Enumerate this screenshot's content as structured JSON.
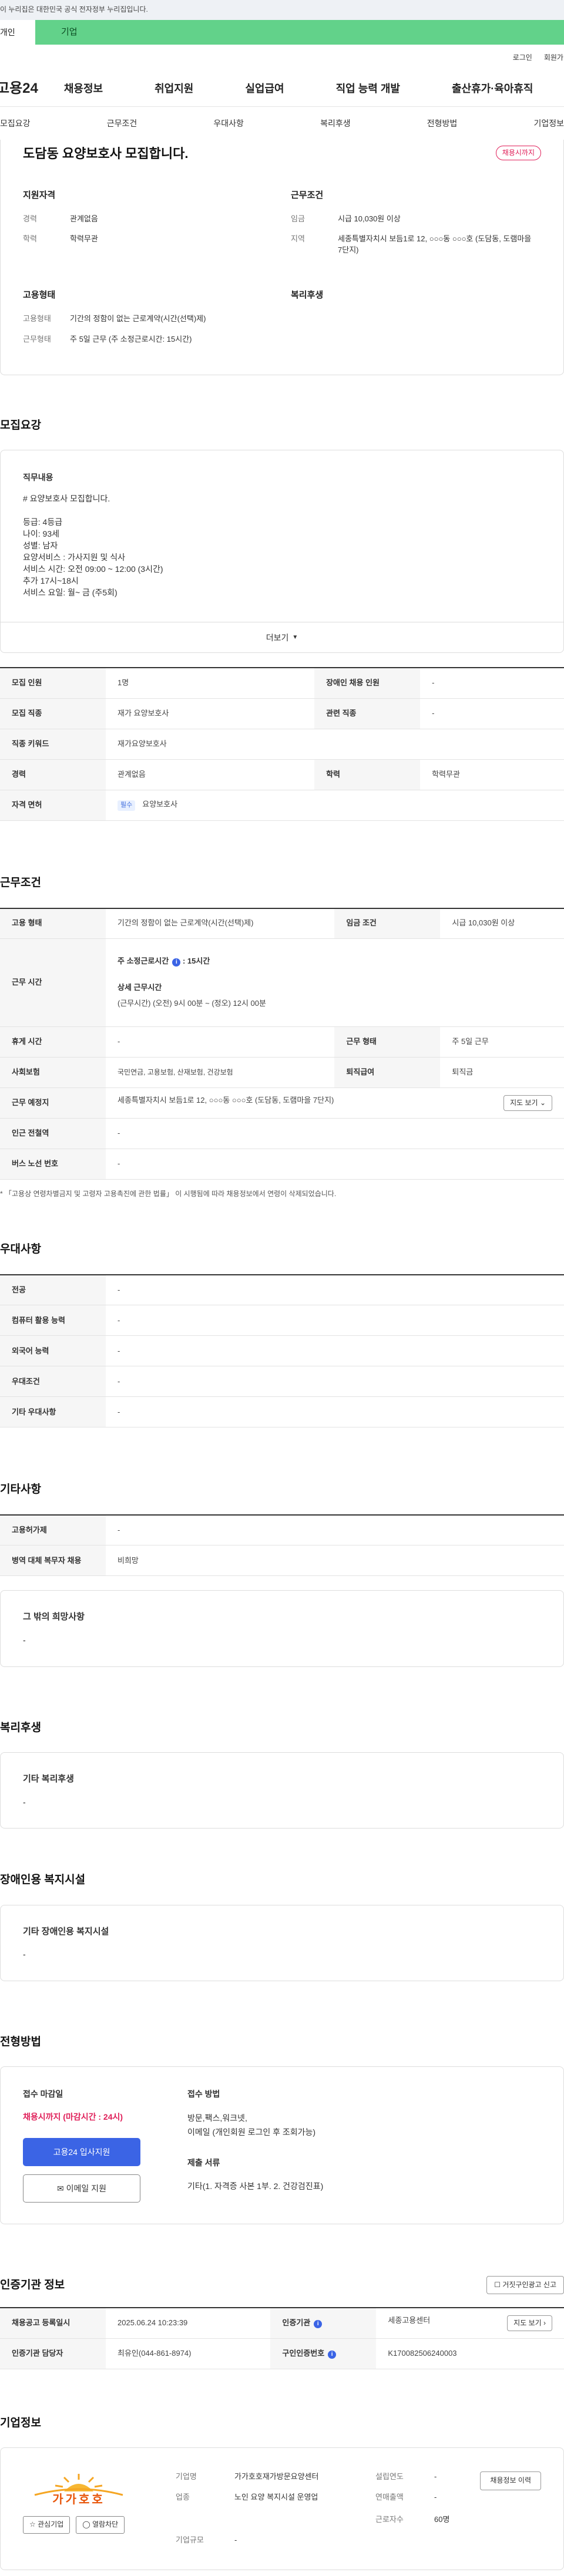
{
  "gov_banner": "이 누리집은 대한민국 공식 전자정부 누리집입니다.",
  "site_tabs": [
    "개인",
    "기업"
  ],
  "util_links": [
    "로그인",
    "회원가입"
  ],
  "logo": "고용24",
  "main_nav": [
    "채용정보",
    "취업지원",
    "실업급여",
    "직업 능력 개발",
    "출산휴가·육아휴직"
  ],
  "anchors": [
    "모집요강",
    "근무조건",
    "우대사항",
    "복리후생",
    "전형방법",
    "기업정보"
  ],
  "summary": {
    "title": "도담동 요양보호사 모집합니다.",
    "status": "채용시까지",
    "qual": {
      "head": "지원자격",
      "rows": [
        {
          "k": "경력",
          "v": "관계없음"
        },
        {
          "k": "학력",
          "v": "학력무관"
        }
      ]
    },
    "cond": {
      "head": "근무조건",
      "rows": [
        {
          "k": "임금",
          "v": "시급 10,030원 이상"
        },
        {
          "k": "지역",
          "v": "세종특별자치시 보듬1로 12, ○○○동 ○○○호 (도담동, 도램마을 7단지)"
        }
      ]
    },
    "emp": {
      "head": "고용형태",
      "rows": [
        {
          "k": "고용형태",
          "v": "기간의 정함이 없는 근로계약(시간(선택)제)"
        },
        {
          "k": "근무형태",
          "v": "주 5일 근무 (주 소정근로시간: 15시간)"
        }
      ]
    },
    "welfare": {
      "head": "복리후생"
    }
  },
  "recruit": {
    "heading": "모집요강",
    "duty_label": "직무내용",
    "duty_text": "# 요양보호사 모집합니다.\n\n등급: 4등급\n나이: 93세\n성별: 남자\n요양서비스 : 가사지원 및 식사\n서비스 시간: 오전 09:00 ~ 12:00 (3시간)\n추가 17시~18시\n서비스 요일: 월~ 금 (주5회)",
    "more": "더보기",
    "rows": [
      {
        "k1": "모집 인원",
        "v1": "1명",
        "k2": "장애인 채용 인원",
        "v2": "-"
      },
      {
        "k1": "모집 직종",
        "v1": "재가 요양보호사",
        "k2": "관련 직종",
        "v2": "-"
      },
      {
        "k1": "직종 키워드",
        "v1": "재가요양보호사"
      },
      {
        "k1": "경력",
        "v1": "관계없음",
        "k2": "학력",
        "v2": "학력무관"
      }
    ],
    "license_label": "자격 면허",
    "license_badge": "필수",
    "license_value": "요양보호사"
  },
  "work": {
    "heading": "근무조건",
    "emp_type_k": "고용 형태",
    "emp_type_v": "기간의 정함이 없는 근로계약(시간(선택)제)",
    "wage_k": "임금 조건",
    "wage_v": "시급 10,030원 이상",
    "hours_k": "근무 시간",
    "weekly_hours": "주 소정근로시간",
    "weekly_hours_v": "15시간",
    "detail_hours": "상세 근무시간",
    "detail_hours_v": "(근무시간) (오전) 9시 00분 ~ (정오) 12시 00분",
    "rest_k": "휴게 시간",
    "rest_v": "-",
    "form_k": "근무 형태",
    "form_v": "주 5일 근무",
    "ins_k": "사회보험",
    "ins_v": "국민연금, 고용보험, 산재보험, 건강보험",
    "ret_k": "퇴직급여",
    "ret_v": "퇴직금",
    "place_k": "근무 예정지",
    "place_v": "세종특별자치시 보듬1로 12, ○○○동 ○○○호 (도담동, 도램마을 7단지)",
    "map_btn": "지도 보기",
    "subway_k": "인근 전철역",
    "subway_v": "-",
    "bus_k": "버스 노선 번호",
    "bus_v": "-",
    "note": "* 「고용상 연령차별금지 및 고령자 고용촉진에 관한 법률」 이 시행됨에 따라 채용정보에서 연령이 삭제되었습니다."
  },
  "pref": {
    "heading": "우대사항",
    "rows": [
      {
        "k": "전공",
        "v": "-"
      },
      {
        "k": "컴퓨터 활용 능력",
        "v": "-"
      },
      {
        "k": "외국어 능력",
        "v": "-"
      },
      {
        "k": "우대조건",
        "v": "-"
      },
      {
        "k": "기타 우대사항",
        "v": "-"
      }
    ]
  },
  "etc": {
    "heading": "기타사항",
    "rows": [
      {
        "k": "고용허가제",
        "v": "-"
      },
      {
        "k": "병역 대체 복무자 채용",
        "v": "비희망"
      }
    ],
    "other_label": "그 밖의 희망사항",
    "other_v": "-"
  },
  "welfare": {
    "heading": "복리후생",
    "label": "기타 복리후생",
    "v": "-"
  },
  "disability": {
    "heading": "장애인용 복지시설",
    "label": "기타 장애인용 복지시설",
    "v": "-"
  },
  "selection": {
    "heading": "전형방법",
    "deadline_label": "접수 마감일",
    "deadline_v": "채용시까지 (마감시간 : 24시)",
    "apply_btn": "고용24 입사지원",
    "email_btn": "이메일 지원",
    "method_label": "접수 방법",
    "method_v1": "방문,팩스,워크넷,",
    "method_v2": "이메일 (개인회원 로그인 후 조회가능)",
    "docs_label": "제출 서류",
    "docs_v": "기타(1. 자격증 사본 1부. 2. 건강검진표)"
  },
  "cert": {
    "heading": "인증기관 정보",
    "report_btn": "거짓구인광고 신고",
    "reg_k": "채용공고 등록일시",
    "reg_v": "2025.06.24 10:23:39",
    "org_k": "인증기관",
    "org_v": "세종고용센터",
    "mgr_k": "인증기관 담당자",
    "mgr_v": "최유인(044-861-8974)",
    "no_k": "구인인증번호",
    "no_v": "K170082506240003",
    "map_btn": "지도 보기"
  },
  "company": {
    "heading": "기업정보",
    "logo_text": "가가호호",
    "fav_btn": "관심기업",
    "block_btn": "열람차단",
    "name_k": "기업명",
    "name_v": "가가호호재가방문요양센터",
    "founded_k": "설립연도",
    "founded_v": "-",
    "biz_k": "업종",
    "biz_v": "노인 요양 복지시설 운영업",
    "sales_k": "연매출액",
    "sales_v": "-",
    "emp_k": "근로자수",
    "emp_v": "60명",
    "size_k": "기업규모",
    "size_v": "-",
    "hist_btn": "채용정보 이력"
  },
  "colors": {
    "accent": "#3b64e5",
    "status": "#e0205a",
    "site_tab": "#62d28a"
  }
}
